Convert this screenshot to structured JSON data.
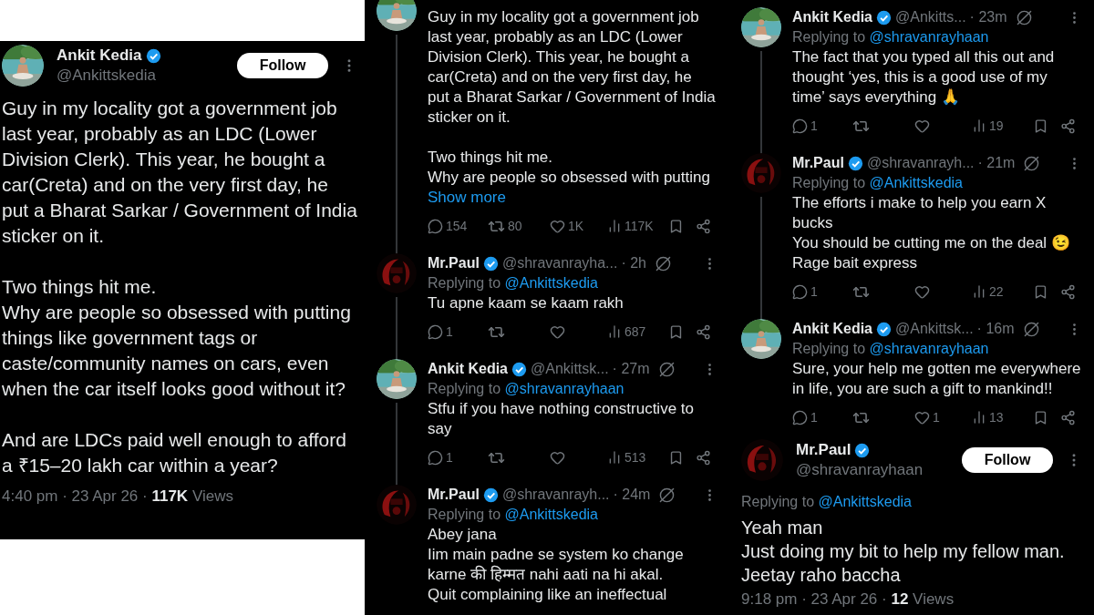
{
  "panels": [
    {
      "posts": [
        {
          "kind": "focused",
          "name": "Ankit Kedia",
          "verified": true,
          "handle": "@Ankittskedia",
          "follow": "Follow",
          "text": "Guy in my locality got a government job last year, probably as an LDC (Lower Division Clerk). This year, he bought a car(Creta) and on the very first day, he put a Bharat Sarkar / Government of India sticker on it.\n\nTwo things hit me.\nWhy are people so obsessed with putting things like government tags or caste/community names on cars, even when the car itself looks good without it?\n\nAnd are LDCs paid well enough to afford a ₹15–20 lakh car within a year?",
          "timestamp": "4:40 pm · 23 Apr 26 ·",
          "views": "117K",
          "views_label": "Views"
        }
      ]
    },
    {
      "posts": [
        {
          "kind": "reply",
          "text": "Guy in my locality got a government job last year, probably as an LDC (Lower Division Clerk). This year, he bought a car(Creta) and on the very first day, he put a Bharat Sarkar / Government of India sticker on it.\n\nTwo things hit me.\nWhy are people so obsessed with putting",
          "show_more": "Show more",
          "stats": {
            "replies": "154",
            "reposts": "80",
            "likes": "1K",
            "views": "117K"
          }
        },
        {
          "kind": "reply",
          "name": "Mr.Paul",
          "verified": true,
          "handle": "@shravanrayha...",
          "age": "· 2h",
          "replying_label": "Replying to",
          "replying_to": "@Ankittskedia",
          "text": "Tu apne kaam se kaam rakh",
          "stats": {
            "replies": "1",
            "views": "687"
          }
        },
        {
          "kind": "reply",
          "name": "Ankit Kedia",
          "verified": true,
          "handle": "@Ankittsk...",
          "age": "· 27m",
          "replying_label": "Replying to",
          "replying_to": "@shravanrayhaan",
          "text": "Stfu if you have nothing constructive to say",
          "stats": {
            "replies": "1",
            "views": "513"
          }
        },
        {
          "kind": "reply",
          "name": "Mr.Paul",
          "verified": true,
          "handle": "@shravanrayh...",
          "age": "· 24m",
          "replying_label": "Replying to",
          "replying_to": "@Ankittskedia",
          "text": "Abey jana\nIim main padne se system ko change karne की हिम्मत nahi aati na hi akal.\nQuit complaining like an ineffectual"
        }
      ]
    },
    {
      "posts": [
        {
          "kind": "reply",
          "name": "Ankit Kedia",
          "verified": true,
          "handle": "@Ankitts...",
          "age": "· 23m",
          "replying_label": "Replying to",
          "replying_to": "@shravanrayhaan",
          "text": "The fact that you typed all this out and thought ‘yes, this is a good use of my time’ says everything 🙏",
          "stats": {
            "replies": "1",
            "views": "19"
          }
        },
        {
          "kind": "reply",
          "name": "Mr.Paul",
          "verified": true,
          "handle": "@shravanrayh...",
          "age": "· 21m",
          "replying_label": "Replying to",
          "replying_to": "@Ankittskedia",
          "text": "The efforts i make to help you earn X bucks\nYou should be cutting me on the deal 😉\nRage bait express",
          "stats": {
            "replies": "1",
            "views": "22"
          }
        },
        {
          "kind": "reply",
          "name": "Ankit Kedia",
          "verified": true,
          "handle": "@Ankittsk...",
          "age": "· 16m",
          "replying_label": "Replying to",
          "replying_to": "@shravanrayhaan",
          "text": "Sure, your help me gotten me everywhere in life, you are such a gift to mankind!!",
          "stats": {
            "replies": "1",
            "likes": "1",
            "views": "13"
          }
        },
        {
          "kind": "focused",
          "name": "Mr.Paul",
          "verified": true,
          "handle": "@shravanrayhaan",
          "follow": "Follow",
          "replying_label": "Replying to",
          "replying_to": "@Ankittskedia",
          "text": "Yeah man\nJust doing my bit to help my fellow man.\nJeetay raho baccha",
          "timestamp": "9:18 pm · 23 Apr 26 ·",
          "views": "12",
          "views_label": "Views"
        }
      ]
    }
  ]
}
